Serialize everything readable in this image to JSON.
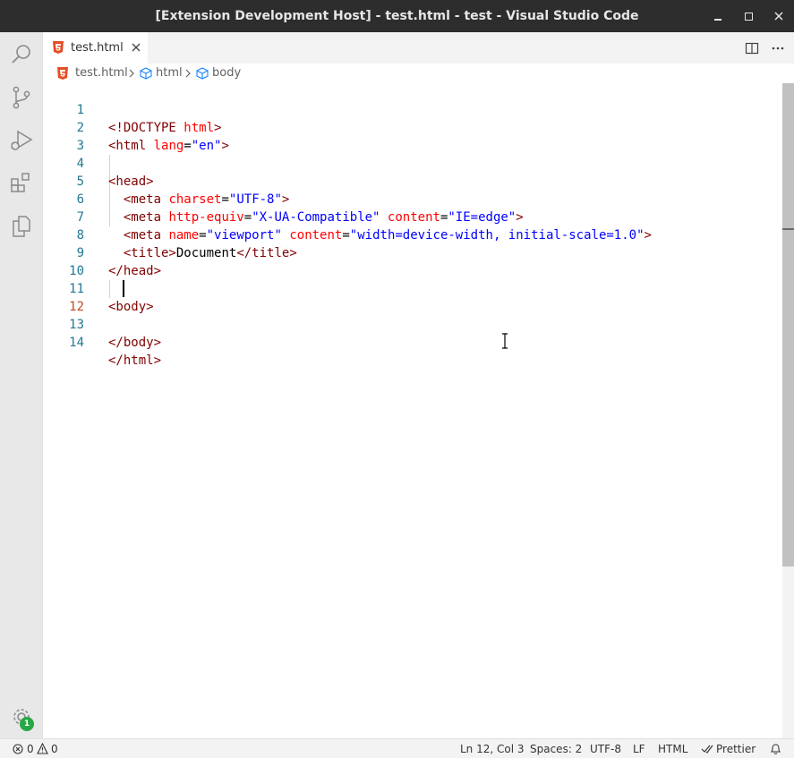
{
  "window": {
    "title": "[Extension Development Host] - test.html - test - Visual Studio Code"
  },
  "activity_bar": {
    "items": [
      "search-icon",
      "source-control-icon",
      "run-debug-icon",
      "extensions-icon",
      "explorer-icon"
    ],
    "settings_badge": "1"
  },
  "tabs": [
    {
      "label": "test.html",
      "icon": "html5-icon",
      "active": true
    }
  ],
  "breadcrumb": {
    "file": "test.html",
    "items": [
      "html",
      "body"
    ]
  },
  "editor": {
    "lines": [
      {
        "n": "1"
      },
      {
        "n": "2"
      },
      {
        "n": "3"
      },
      {
        "n": "4"
      },
      {
        "n": "5"
      },
      {
        "n": "6"
      },
      {
        "n": "7"
      },
      {
        "n": "8"
      },
      {
        "n": "9"
      },
      {
        "n": "10"
      },
      {
        "n": "11"
      },
      {
        "n": "12"
      },
      {
        "n": "13"
      },
      {
        "n": "14"
      }
    ],
    "code": {
      "l1_doctype": "<!DOCTYPE",
      "l1_html": "html",
      "l1_close": ">",
      "l2_open": "<html",
      "l2_attr": "lang",
      "l2_val": "\"en\"",
      "l2_close": ">",
      "l4": "<head>",
      "l5_open": "<meta",
      "l5_attr": "charset",
      "l5_val": "\"UTF-8\"",
      "l5_close": ">",
      "l6_open": "<meta",
      "l6_attr1": "http-equiv",
      "l6_val1": "\"X-UA-Compatible\"",
      "l6_attr2": "content",
      "l6_val2": "\"IE=edge\"",
      "l6_close": ">",
      "l7_open": "<meta",
      "l7_attr1": "name",
      "l7_val1": "\"viewport\"",
      "l7_attr2": "content",
      "l7_val2": "\"width=device-width, initial-scale=1.0\"",
      "l7_close": ">",
      "l8_open": "<title>",
      "l8_text": "Document",
      "l8_close": "</title>",
      "l9": "</head>",
      "l11": "<body>",
      "l13": "</body>",
      "l14": "</html>"
    },
    "active_line": "12"
  },
  "statusbar": {
    "errors": "0",
    "warnings": "0",
    "position": "Ln 12, Col 3",
    "spaces": "Spaces: 2",
    "encoding": "UTF-8",
    "eol": "LF",
    "language": "HTML",
    "formatter": "Prettier"
  }
}
